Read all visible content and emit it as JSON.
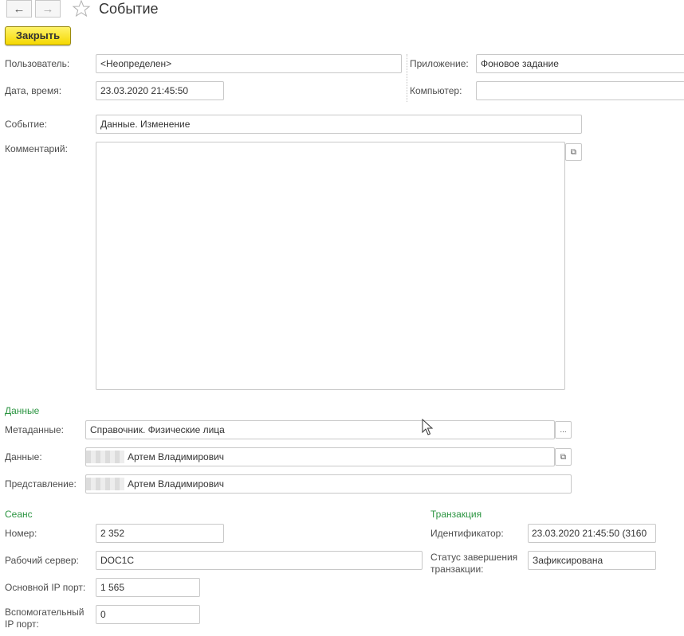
{
  "window": {
    "title": "Событие"
  },
  "toolbar": {
    "back_icon": "arrow-left-icon",
    "forward_icon": "arrow-right-icon",
    "favorite_icon": "star-icon",
    "close_label": "Закрыть"
  },
  "header": {
    "user_label": "Пользователь:",
    "user_value": "<Неопределен>",
    "datetime_label": "Дата, время:",
    "datetime_value": "23.03.2020 21:45:50",
    "app_label": "Приложение:",
    "app_value": "Фоновое задание",
    "computer_label": "Компьютер:",
    "computer_value": "",
    "event_label": "Событие:",
    "event_value": "Данные. Изменение",
    "comment_label": "Комментарий:",
    "comment_value": ""
  },
  "data_section": {
    "title": "Данные",
    "metadata_label": "Метаданные:",
    "metadata_value": "Справочник. Физические лица",
    "data_label": "Данные:",
    "data_value": "Артем Владимирович",
    "presentation_label": "Представление:",
    "presentation_value": "Артем Владимирович"
  },
  "session": {
    "title": "Сеанс",
    "number_label": "Номер:",
    "number_value": "2 352",
    "server_label": "Рабочий сервер:",
    "server_value": "DOC1C",
    "main_port_label": "Основной IP порт:",
    "main_port_value": "1 565",
    "aux_port_label_1": "Вспомогательный",
    "aux_port_label_2": "IP порт:",
    "aux_port_value": "0"
  },
  "transaction": {
    "title": "Транзакция",
    "id_label": "Идентификатор:",
    "id_value": "23.03.2020 21:45:50 (3160",
    "status_label_1": "Статус завершения",
    "status_label_2": "транзакции:",
    "status_value": "Зафиксирована"
  }
}
